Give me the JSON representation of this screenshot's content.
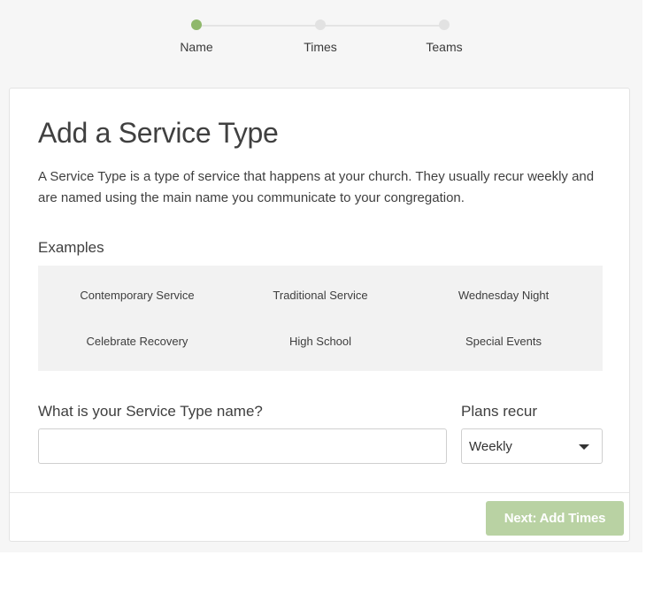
{
  "stepper": {
    "steps": [
      {
        "label": "Name",
        "state": "active"
      },
      {
        "label": "Times",
        "state": "inactive"
      },
      {
        "label": "Teams",
        "state": "inactive"
      }
    ],
    "active_color": "#8fb86b",
    "inactive_color": "#e2e2e2"
  },
  "card": {
    "title": "Add a Service Type",
    "description": "A Service Type is a type of service that happens at your church. They usually recur weekly and are named using the main name you communicate to your congregation.",
    "examples_heading": "Examples",
    "examples": [
      "Contemporary Service",
      "Traditional Service",
      "Wednesday Night",
      "Celebrate Recovery",
      "High School",
      "Special Events"
    ],
    "name_field": {
      "label": "What is your Service Type name?",
      "value": "",
      "placeholder": ""
    },
    "recur_field": {
      "label": "Plans recur",
      "selected": "Weekly"
    },
    "next_button": {
      "label": "Next: Add Times",
      "color": "#b9d2a3"
    }
  }
}
